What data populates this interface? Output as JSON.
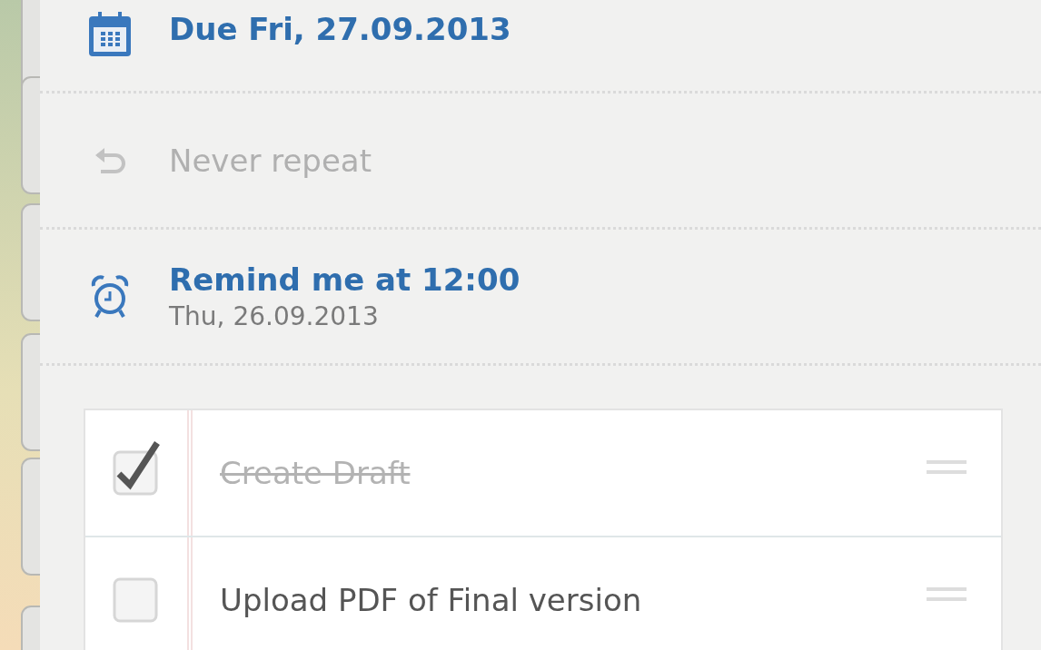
{
  "due": {
    "label": "Due Fri, 27.09.2013"
  },
  "repeat": {
    "label": "Never repeat",
    "active": false
  },
  "reminder": {
    "title": "Remind me at 12:00",
    "date": "Thu, 26.09.2013"
  },
  "subtasks": [
    {
      "title": "Create Draft",
      "checked": true
    },
    {
      "title": "Upload PDF of Final version",
      "checked": false
    }
  ]
}
